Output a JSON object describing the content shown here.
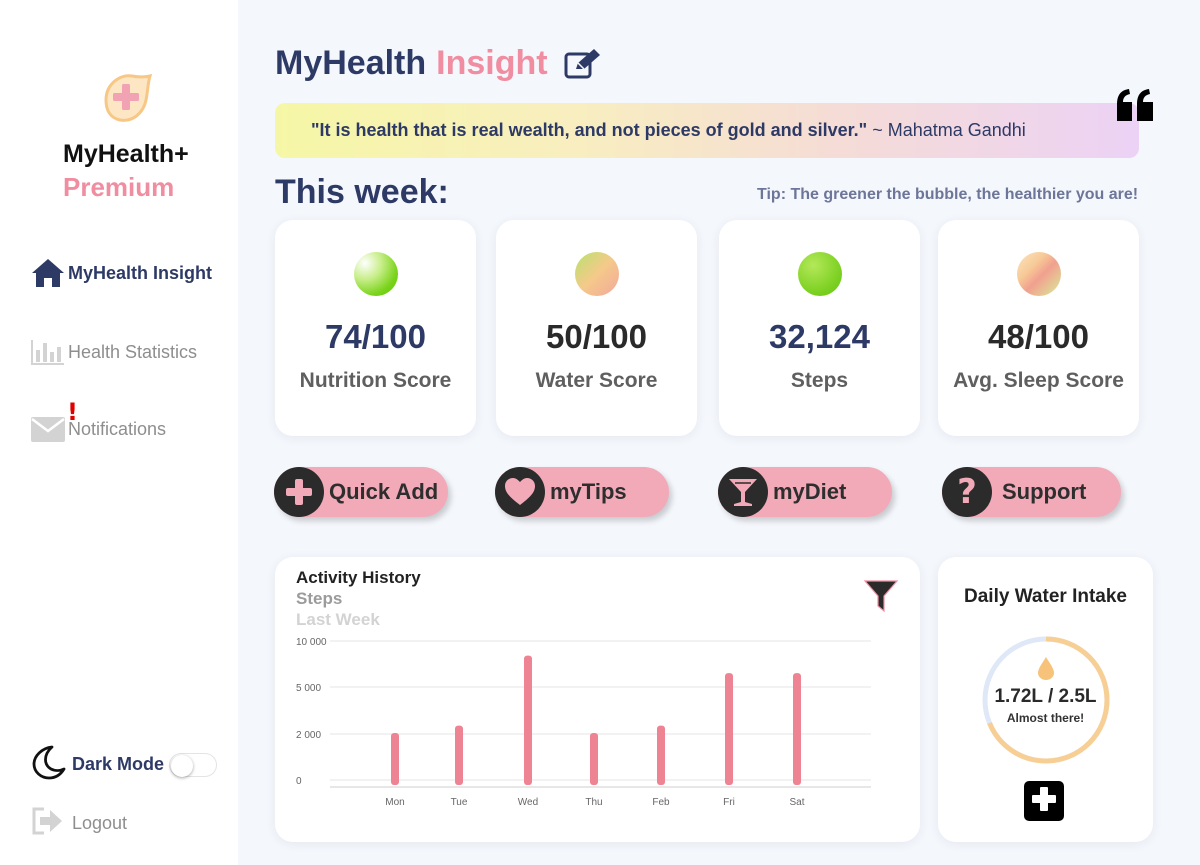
{
  "brand": {
    "name": "MyHealth+",
    "tier": "Premium",
    "logo_icon": "medical-plus-leaf-icon",
    "accent_color": "#f08da0",
    "navy_color": "#2e3a66"
  },
  "sidebar": {
    "items": [
      {
        "label": "MyHealth Insight",
        "icon": "home-icon",
        "active": true
      },
      {
        "label": "Health Statistics",
        "icon": "bar-chart-icon",
        "active": false
      },
      {
        "label": "Notifications",
        "icon": "mail-icon",
        "active": false,
        "alert": "!"
      }
    ],
    "dark_mode": {
      "label": "Dark Mode",
      "icon": "moon-icon",
      "enabled": false
    },
    "logout": {
      "label": "Logout",
      "icon": "logout-icon"
    }
  },
  "header": {
    "title_main": "MyHealth",
    "title_accent": "Insight",
    "edit_icon": "edit-icon"
  },
  "quote": {
    "text": "\"It is health that is real wealth, and not pieces of gold and silver.\"",
    "author": "~ Mahatma Gandhi",
    "icon": "quote-icon"
  },
  "week": {
    "title": "This week:",
    "tip": "Tip: The greener the bubble, the healthier you are!"
  },
  "stats": [
    {
      "value": "74/100",
      "label": "Nutrition Score",
      "bubble_colors": [
        "#ffffff",
        "#8fd92a",
        "#5fc50a"
      ],
      "value_color": "#2e3a66"
    },
    {
      "value": "50/100",
      "label": "Water Score",
      "bubble_colors": [
        "#b8e26e",
        "#f5c98a",
        "#f2a89b"
      ],
      "value_color": "#2a2a2a"
    },
    {
      "value": "32,124",
      "label": "Steps",
      "bubble_colors": [
        "#a4e04a",
        "#7fd12a",
        "#5fc50a"
      ],
      "value_color": "#2e3a66"
    },
    {
      "value": "48/100",
      "label": "Avg. Sleep Score",
      "bubble_colors": [
        "#d8ee9a",
        "#f7c896",
        "#f1a08f"
      ],
      "value_color": "#2a2a2a"
    }
  ],
  "actions": [
    {
      "label": "Quick Add",
      "icon": "plus-icon"
    },
    {
      "label": "myTips",
      "icon": "heart-icon"
    },
    {
      "label": "myDiet",
      "icon": "cocktail-glass-icon"
    },
    {
      "label": "Support",
      "icon": "question-icon"
    }
  ],
  "activity": {
    "title": "Activity History",
    "metric": "Steps",
    "range": "Last Week",
    "filter_icon": "filter-icon"
  },
  "chart_data": {
    "type": "bar",
    "categories": [
      "Mon",
      "Tue",
      "Wed",
      "Thu",
      "Feb",
      "Fri",
      "Sat"
    ],
    "values": [
      3700,
      4200,
      9000,
      3700,
      4200,
      7800,
      7800
    ],
    "yticks": [
      "10 000",
      "5 000",
      "2 000",
      "0"
    ],
    "ylim": [
      0,
      10000
    ],
    "xlabel": "",
    "ylabel": "",
    "grid": true,
    "bar_color": "#ee8393"
  },
  "water": {
    "title": "Daily Water Intake",
    "amount": "1.72L / 2.5L",
    "status": "Almost there!",
    "progress": 0.688,
    "progress_color": "#f7cf94",
    "track_color": "#dfe8f7",
    "drop_color": "#f7c27a",
    "add_icon": "plus-icon"
  }
}
